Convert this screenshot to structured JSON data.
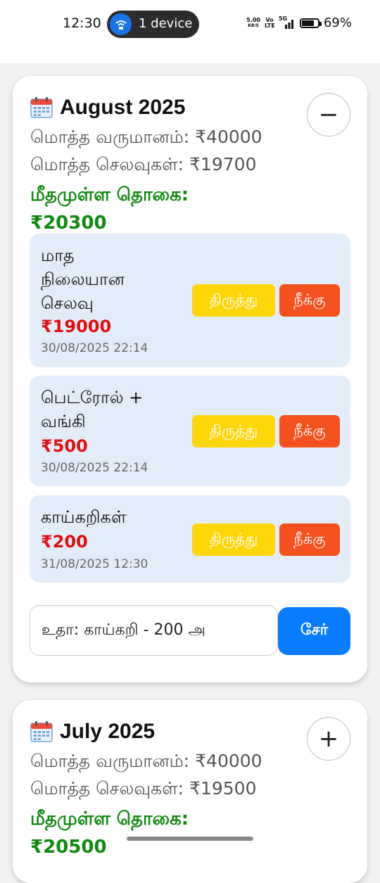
{
  "status_bar": {
    "time": "12:30",
    "device_label": "1 device",
    "net_speed_value": "5.00",
    "net_speed_unit": "KB/S",
    "volte": "Vo LTE",
    "network": "5G",
    "battery": "69%"
  },
  "months": [
    {
      "title": "August 2025",
      "toggle": "−",
      "total_income": "மொத்த வருமானம்: ₹40000",
      "total_expenses": "மொத்த செலவுகள்: ₹19700",
      "balance_label": "மீதமுள்ள தொகை:",
      "balance_value": "₹20300",
      "expenses": [
        {
          "name": "மாத நிலையான செலவு",
          "amount": "₹19000",
          "date": "30/08/2025 22:14"
        },
        {
          "name": "பெட்ரோல் + வங்கி",
          "amount": "₹500",
          "date": "30/08/2025 22:14"
        },
        {
          "name": "காய்கறிகள்",
          "amount": "₹200",
          "date": "31/08/2025 12:30"
        }
      ],
      "edit_label": "திருத்து",
      "delete_label": "நீக்கு",
      "input_placeholder": "உதா: காய்கறி - 200 அ",
      "add_label": "சேர்"
    },
    {
      "title": "July 2025",
      "toggle": "+",
      "total_income": "மொத்த வருமானம்: ₹40000",
      "total_expenses": "மொத்த செலவுகள்: ₹19500",
      "balance_label": "மீதமுள்ள தொகை:",
      "balance_value": "₹20500"
    }
  ],
  "colors": {
    "balance": "#118a11",
    "amount": "#e01010",
    "edit": "#ffd60a",
    "delete": "#f4511e",
    "add": "#0a7cff"
  }
}
